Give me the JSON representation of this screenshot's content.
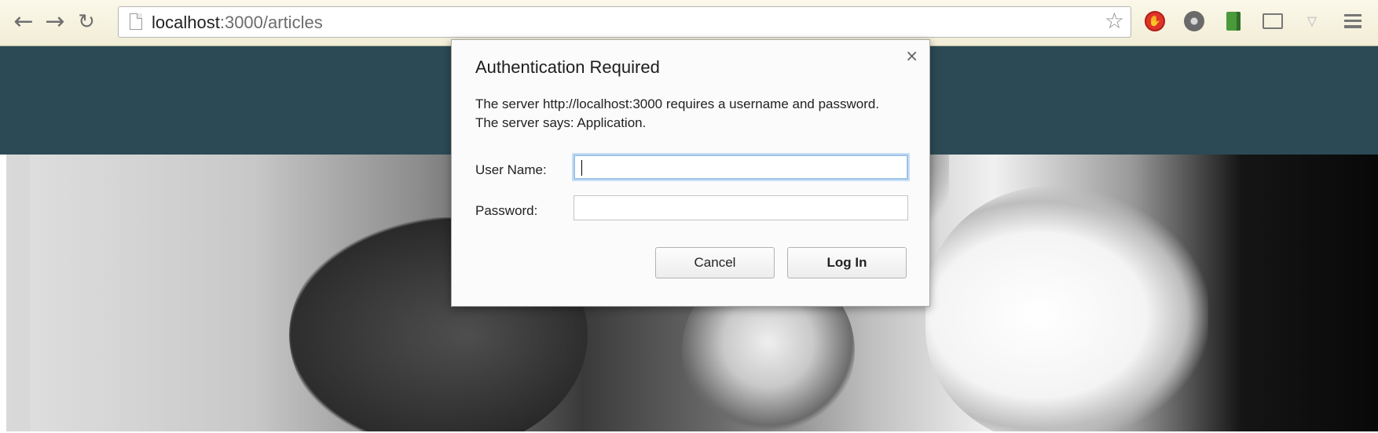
{
  "browser": {
    "url_host": "localhost",
    "url_path": ":3000/articles",
    "icons": {
      "back": "arrow-left-icon",
      "forward": "arrow-right-icon",
      "reload": "reload-icon",
      "page": "page-icon",
      "bookmark": "star-icon",
      "menu": "hamburger-menu-icon"
    }
  },
  "header_band_color": "#2b4a55",
  "dialog": {
    "title": "Authentication Required",
    "message": "The server http://localhost:3000 requires a username and password. The server says: Application.",
    "close_glyph": "×",
    "username_label": "User Name:",
    "username_value": "",
    "password_label": "Password:",
    "password_value": "",
    "cancel_label": "Cancel",
    "login_label": "Log In"
  }
}
